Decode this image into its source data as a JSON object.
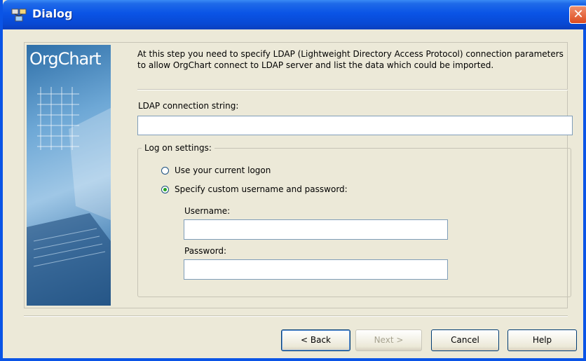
{
  "window": {
    "title": "Dialog",
    "close_symbol": "✕"
  },
  "banner": {
    "logo_text": "OrgChart"
  },
  "description": "At this step you need to specify LDAP (Lightweight Directory Access Protocol) connection parameters to allow OrgChart connect to LDAP server and list the data which could be imported.",
  "ldap": {
    "label": "LDAP connection string:",
    "value": ""
  },
  "logon": {
    "legend": "Log on settings:",
    "options": [
      {
        "label": "Use your current logon",
        "selected": false
      },
      {
        "label": "Specify custom username and password:",
        "selected": true
      }
    ],
    "username_label": "Username:",
    "username_value": "",
    "password_label": "Password:",
    "password_value": ""
  },
  "buttons": {
    "back": "< Back",
    "next": "Next >",
    "cancel": "Cancel",
    "help": "Help"
  },
  "icons": {
    "title": "app-icon",
    "close": "close-icon"
  }
}
